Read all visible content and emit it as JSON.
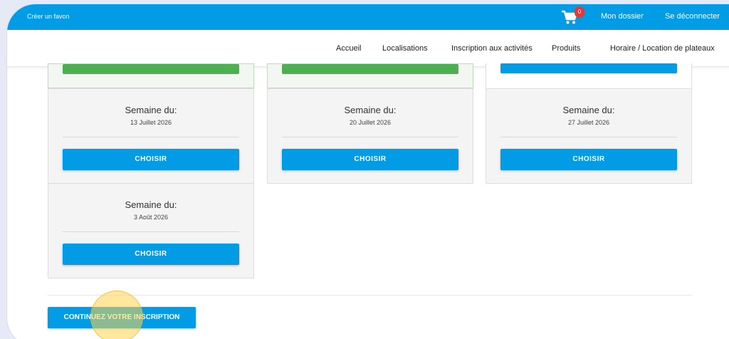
{
  "topbar": {
    "favorite_label": "Créer un favon",
    "cart_count": "0",
    "my_file": "Mon dossier",
    "logout": "Se déconnecter",
    "background": "#029be5"
  },
  "nav": {
    "items": [
      "Accueil",
      "Localisations",
      "Inscription aux activités",
      "Produits",
      "Horaire / Location de plateaux"
    ]
  },
  "weeks": [
    {
      "title": "Semaine du:",
      "date": "13 Juillet 2026",
      "button": "CHOISIR"
    },
    {
      "title": "Semaine du:",
      "date": "20 Juillet 2026",
      "button": "CHOISIR"
    },
    {
      "title": "Semaine du:",
      "date": "27 Juillet 2026",
      "button": "CHOISIR"
    },
    {
      "title": "Semaine du:",
      "date": "3 Août 2026",
      "button": "CHOISIR"
    }
  ],
  "continue_button": "CONTINUEZ VOTRE INSCRIPTION",
  "colors": {
    "primary": "#029be5",
    "selected": "#4caf50"
  }
}
